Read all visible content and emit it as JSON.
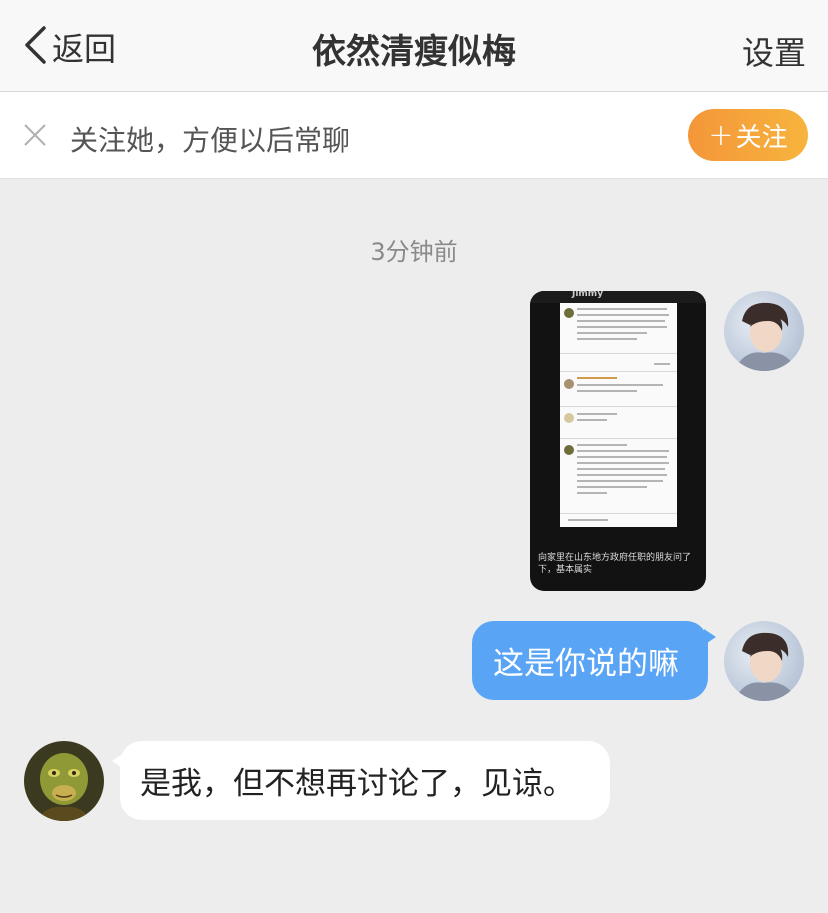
{
  "nav": {
    "back_label": "返回",
    "title": "依然清瘦似梅",
    "settings_label": "设置"
  },
  "follow_prompt": {
    "text": "关注她，方便以后常聊",
    "button_label": "关注"
  },
  "timestamp": "3分钟前",
  "messages": [
    {
      "direction": "outgoing",
      "type": "image",
      "screenshot": {
        "header_name": "Jimmy",
        "caption": "向家里在山东地方政府任职的朋友问了下，基本属实"
      }
    },
    {
      "direction": "outgoing",
      "type": "text",
      "text": "这是你说的嘛"
    },
    {
      "direction": "incoming",
      "type": "text",
      "text": "是我，但不想再讨论了，见谅。"
    }
  ],
  "colors": {
    "outgoing_bubble": "#5aa4f5",
    "incoming_bubble": "#ffffff",
    "follow_button": "#f4963a",
    "background": "#ededed"
  }
}
